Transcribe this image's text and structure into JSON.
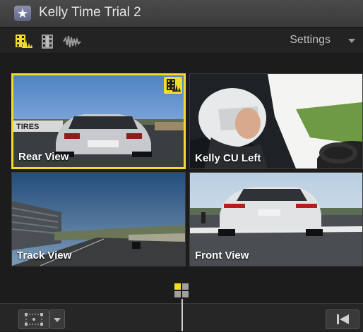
{
  "window": {
    "title": "Kelly Time Trial 2"
  },
  "toolbar": {
    "icons": [
      "multicam-video-audio-icon",
      "video-only-icon",
      "audio-only-icon"
    ],
    "settings_label": "Settings",
    "accent_color": "#f2dc2a"
  },
  "angles": [
    {
      "label": "Rear View",
      "active": true
    },
    {
      "label": "Kelly CU Left",
      "active": false
    },
    {
      "label": "Track View",
      "active": false
    },
    {
      "label": "Front View",
      "active": false
    }
  ],
  "bottom": {
    "icons": [
      "transform-icon",
      "dropdown-arrow-icon",
      "go-to-start-icon"
    ]
  }
}
